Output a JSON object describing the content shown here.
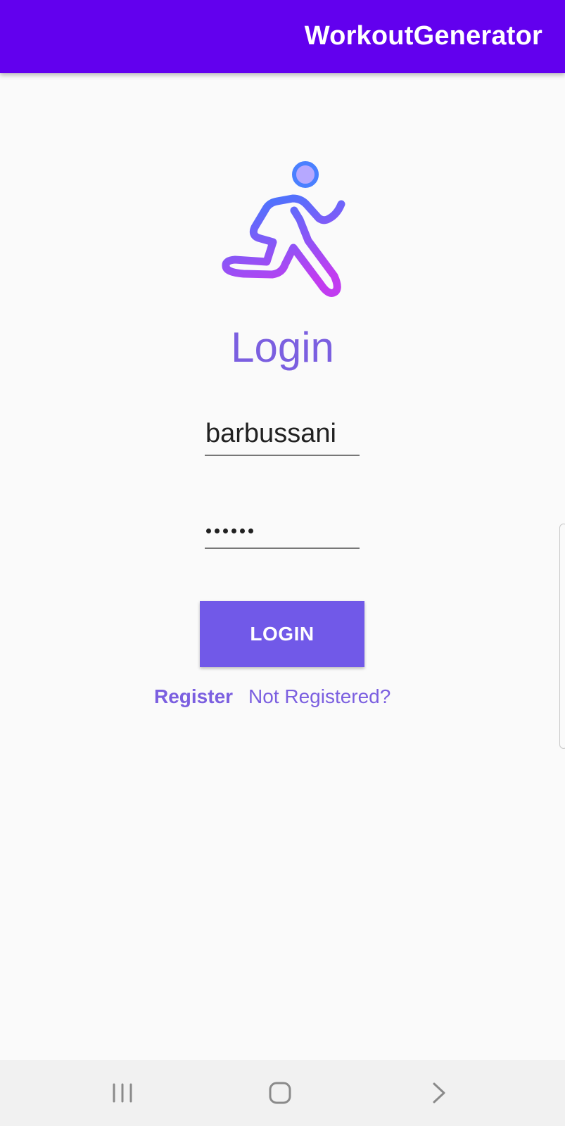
{
  "app_bar": {
    "title": "WorkoutGenerator",
    "background": "#6200ee"
  },
  "logo": {
    "icon": "running-person-icon"
  },
  "form": {
    "heading": "Login",
    "username_value": "barbussani",
    "password_masked": "••••••",
    "login_button_label": "LOGIN",
    "register_link": "Register",
    "register_prompt": "Not Registered?"
  },
  "colors": {
    "accent": "#7159e8",
    "text_accent": "#7b5fe0",
    "logo_gradient_start": "#3d7bff",
    "logo_gradient_end": "#c13cf0"
  },
  "system_nav": {
    "recents_icon": "recents-icon",
    "home_icon": "home-icon",
    "back_icon": "back-chevron-icon"
  }
}
